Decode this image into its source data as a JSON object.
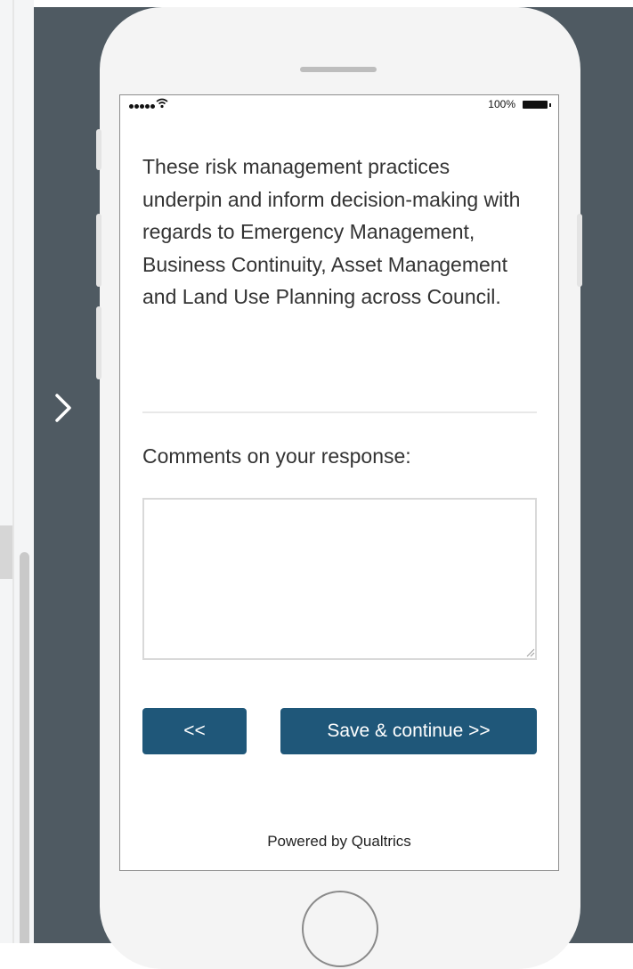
{
  "preview": {
    "next_arrow_icon": "chevron-right-icon"
  },
  "status_bar": {
    "battery_text": "100%"
  },
  "survey": {
    "question_text": "These risk management practices underpin and inform decision-making with regards to Emergency Management, Business Continuity, Asset Management and Land Use Planning across Council.",
    "comments_label": "Comments on your response:",
    "comments_value": "",
    "back_button_label": "<<",
    "next_button_label": "Save & continue >>",
    "footer_text": "Powered by Qualtrics"
  },
  "colors": {
    "stage_background": "#4f5a62",
    "button_background": "#1f5779"
  }
}
